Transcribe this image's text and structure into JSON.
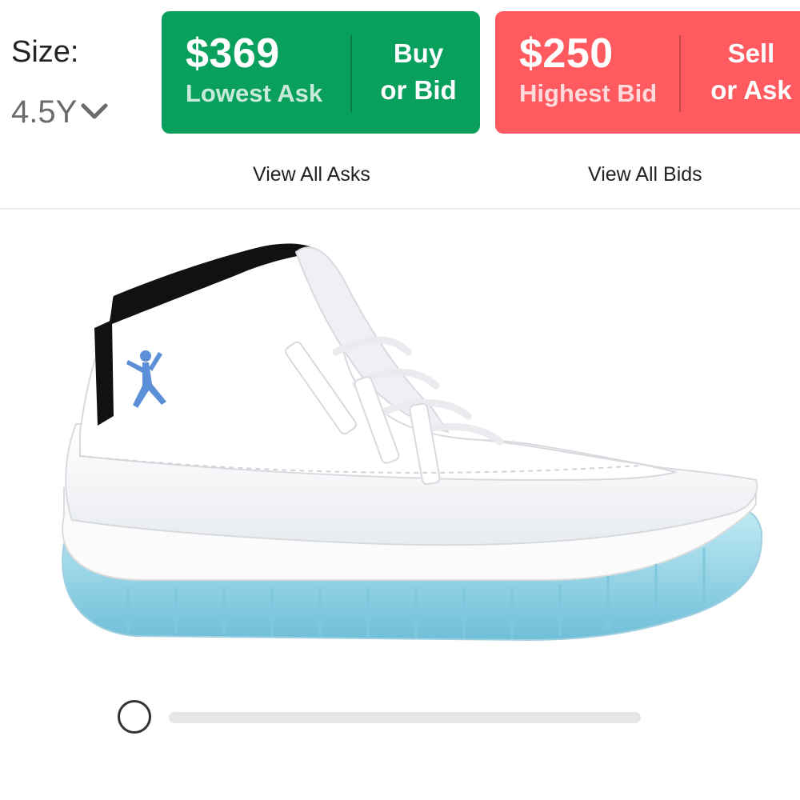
{
  "size": {
    "label": "Size:",
    "value": "4.5Y",
    "chevron_icon": "chevron-down-icon"
  },
  "ask": {
    "price": "$369",
    "caption": "Lowest Ask",
    "action_line1": "Buy",
    "action_line2": "or Bid",
    "color": "#08a05c"
  },
  "bid": {
    "price": "$250",
    "caption": "Highest Bid",
    "action_line1": "Sell",
    "action_line2": "or Ask",
    "color": "#ff5a5f"
  },
  "links": {
    "view_asks": "View All Asks",
    "view_bids": "View All Bids"
  },
  "product": {
    "sole_color": "#8fd3e6",
    "logo_color": "#5b8fd8"
  },
  "viewer": {
    "position": 0
  }
}
